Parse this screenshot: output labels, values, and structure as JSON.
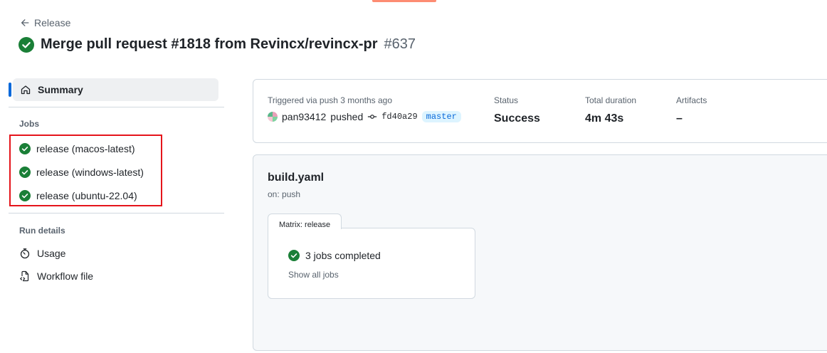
{
  "header": {
    "back_label": "Release",
    "title": "Merge pull request #1818 from Revincx/revincx-pr",
    "run_number": "#637"
  },
  "sidebar": {
    "summary_label": "Summary",
    "jobs_heading": "Jobs",
    "jobs": [
      {
        "label": "release (macos-latest)",
        "status": "success"
      },
      {
        "label": "release (windows-latest)",
        "status": "success"
      },
      {
        "label": "release (ubuntu-22.04)",
        "status": "success"
      }
    ],
    "run_details_heading": "Run details",
    "run_details": [
      {
        "label": "Usage",
        "icon": "stopwatch-icon"
      },
      {
        "label": "Workflow file",
        "icon": "file-code-icon"
      }
    ]
  },
  "status_card": {
    "trigger_label": "Triggered via push 3 months ago",
    "actor": "pan93412",
    "action": "pushed",
    "commit_sha": "fd40a29",
    "branch": "master",
    "status_label": "Status",
    "status_value": "Success",
    "duration_label": "Total duration",
    "duration_value": "4m 43s",
    "artifacts_label": "Artifacts",
    "artifacts_value": "–"
  },
  "workflow": {
    "file": "build.yaml",
    "trigger": "on: push",
    "matrix_label": "Matrix: release",
    "matrix_status": "3 jobs completed",
    "show_all": "Show all jobs"
  },
  "colors": {
    "success": "#1a7f37",
    "accent": "#0969da",
    "highlight_box": "#e5141b"
  }
}
